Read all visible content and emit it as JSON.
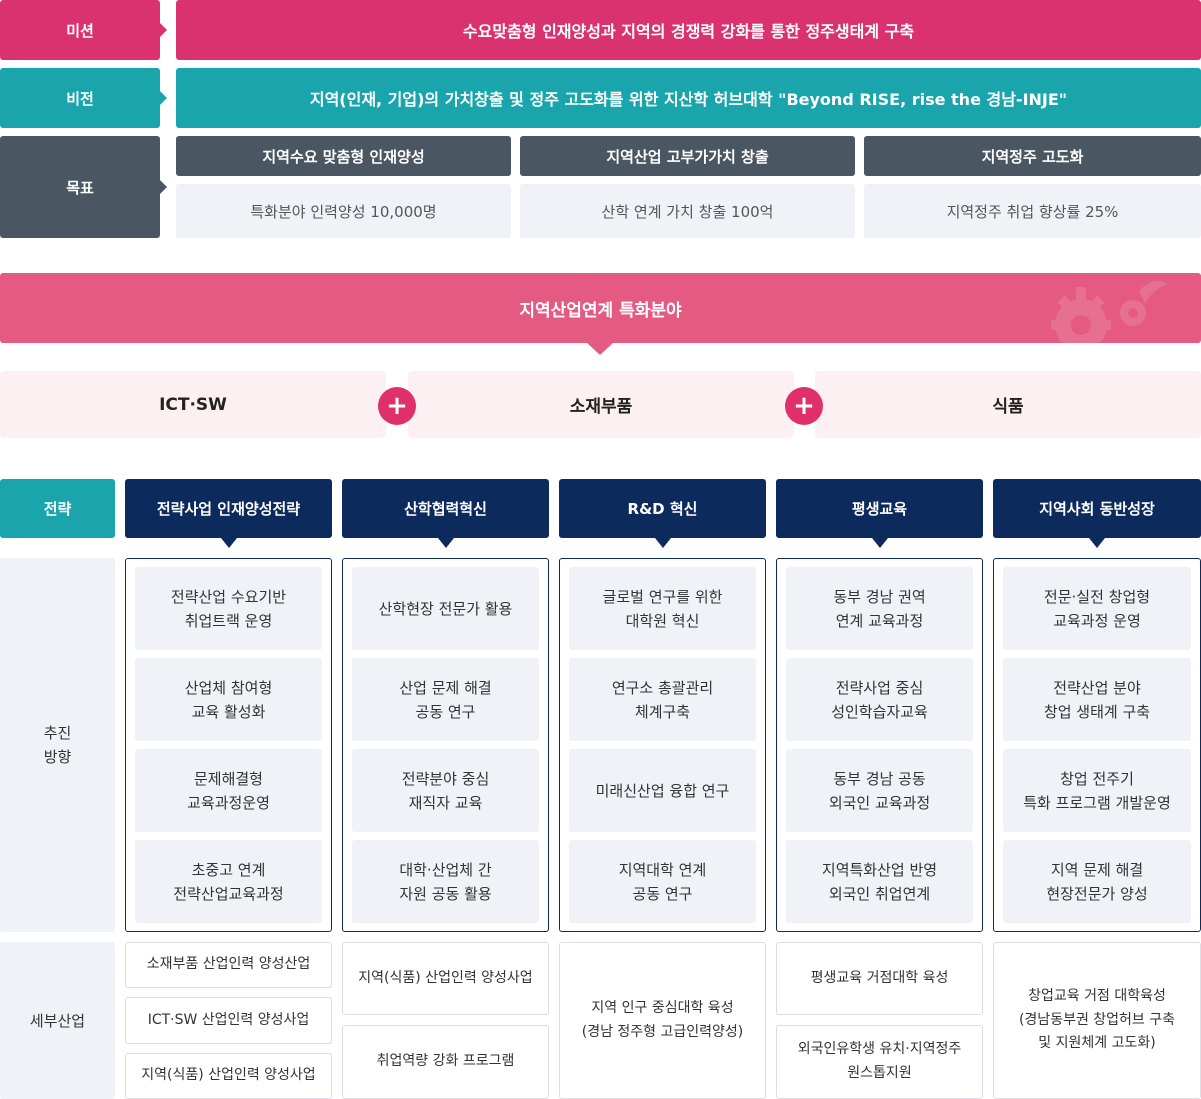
{
  "mission": {
    "label": "미션",
    "text": "수요맞춤형 인재양성과 지역의 경쟁력 강화를 통한 정주생태계 구축"
  },
  "vision": {
    "label": "비전",
    "text": "지역(인재, 기업)의 가치창출 및 정주 고도화를 위한 지산학 허브대학 \"Beyond RISE, rise the 경남-INJE\""
  },
  "goal": {
    "label": "목표",
    "items": [
      {
        "title": "지역수요 맞춤형 인재양성",
        "value": "특화분야 인력양성 10,000명"
      },
      {
        "title": "지역산업 고부가가치 창출",
        "value": "산학 연계 가치 창출 100억"
      },
      {
        "title": "지역정주 고도화",
        "value": "지역정주 취업 향상률 25%"
      }
    ]
  },
  "special": {
    "title": "지역산업연계 특화분야",
    "fields": [
      "ICT·SW",
      "소재부품",
      "식품"
    ],
    "plus": "+"
  },
  "strategy": {
    "label": "전략",
    "direction_label": [
      "추진",
      "방향"
    ],
    "sub_label": "세부산업",
    "columns": [
      {
        "title": "전략사업 인재양성전략",
        "items": [
          [
            "전략산업 수요기반",
            "취업트랙 운영"
          ],
          [
            "산업체 참여형",
            "교육 활성화"
          ],
          [
            "문제해결형",
            "교육과정운영"
          ],
          [
            "초중고 연계",
            "전략산업교육과정"
          ]
        ],
        "sub": [
          [
            "소재부품 산업인력 양성산업"
          ],
          [
            "ICT·SW 산업인력 양성사업"
          ],
          [
            "지역(식품) 산업인력 양성사업"
          ]
        ]
      },
      {
        "title": "산학협력혁신",
        "items": [
          [
            "산학현장 전문가 활용"
          ],
          [
            "산업 문제 해결",
            "공동 연구"
          ],
          [
            "전략분야 중심",
            "재직자 교육"
          ],
          [
            "대학·산업체 간",
            "자원 공동 활용"
          ]
        ],
        "sub": [
          [
            "지역(식품) 산업인력 양성사업"
          ],
          [
            "취업역량 강화 프로그램"
          ]
        ]
      },
      {
        "title": "R&D 혁신",
        "items": [
          [
            "글로벌 연구를 위한",
            "대학원 혁신"
          ],
          [
            "연구소 총괄관리",
            "체계구축"
          ],
          [
            "미래신산업 융합 연구"
          ],
          [
            "지역대학 연계",
            "공동 연구"
          ]
        ],
        "sub": [
          [
            "지역 인구 중심대학 육성",
            "(경남 정주형 고급인력양성)"
          ]
        ]
      },
      {
        "title": "평생교육",
        "items": [
          [
            "동부 경남 권역",
            "연계 교육과정"
          ],
          [
            "전략사업 중심",
            "성인학습자교육"
          ],
          [
            "동부 경남 공동",
            "외국인 교육과정"
          ],
          [
            "지역특화산업 반영",
            "외국인 취업연계"
          ]
        ],
        "sub": [
          [
            "평생교육 거점대학 육성"
          ],
          [
            "외국인유학생 유치·지역정주",
            "원스톱지원"
          ]
        ]
      },
      {
        "title": "지역사회 동반성장",
        "items": [
          [
            "전문·실전 창업형",
            "교육과정 운영"
          ],
          [
            "전략산업 분야",
            "창업 생태계 구축"
          ],
          [
            "창업 전주기",
            "특화 프로그램 개발운영"
          ],
          [
            "지역 문제 해결",
            "현장전문가 양성"
          ]
        ],
        "sub": [
          [
            "창업교육 거점 대학육성",
            "(경남동부권 창업허브 구축",
            "및 지원체계 고도화)"
          ]
        ]
      }
    ]
  }
}
